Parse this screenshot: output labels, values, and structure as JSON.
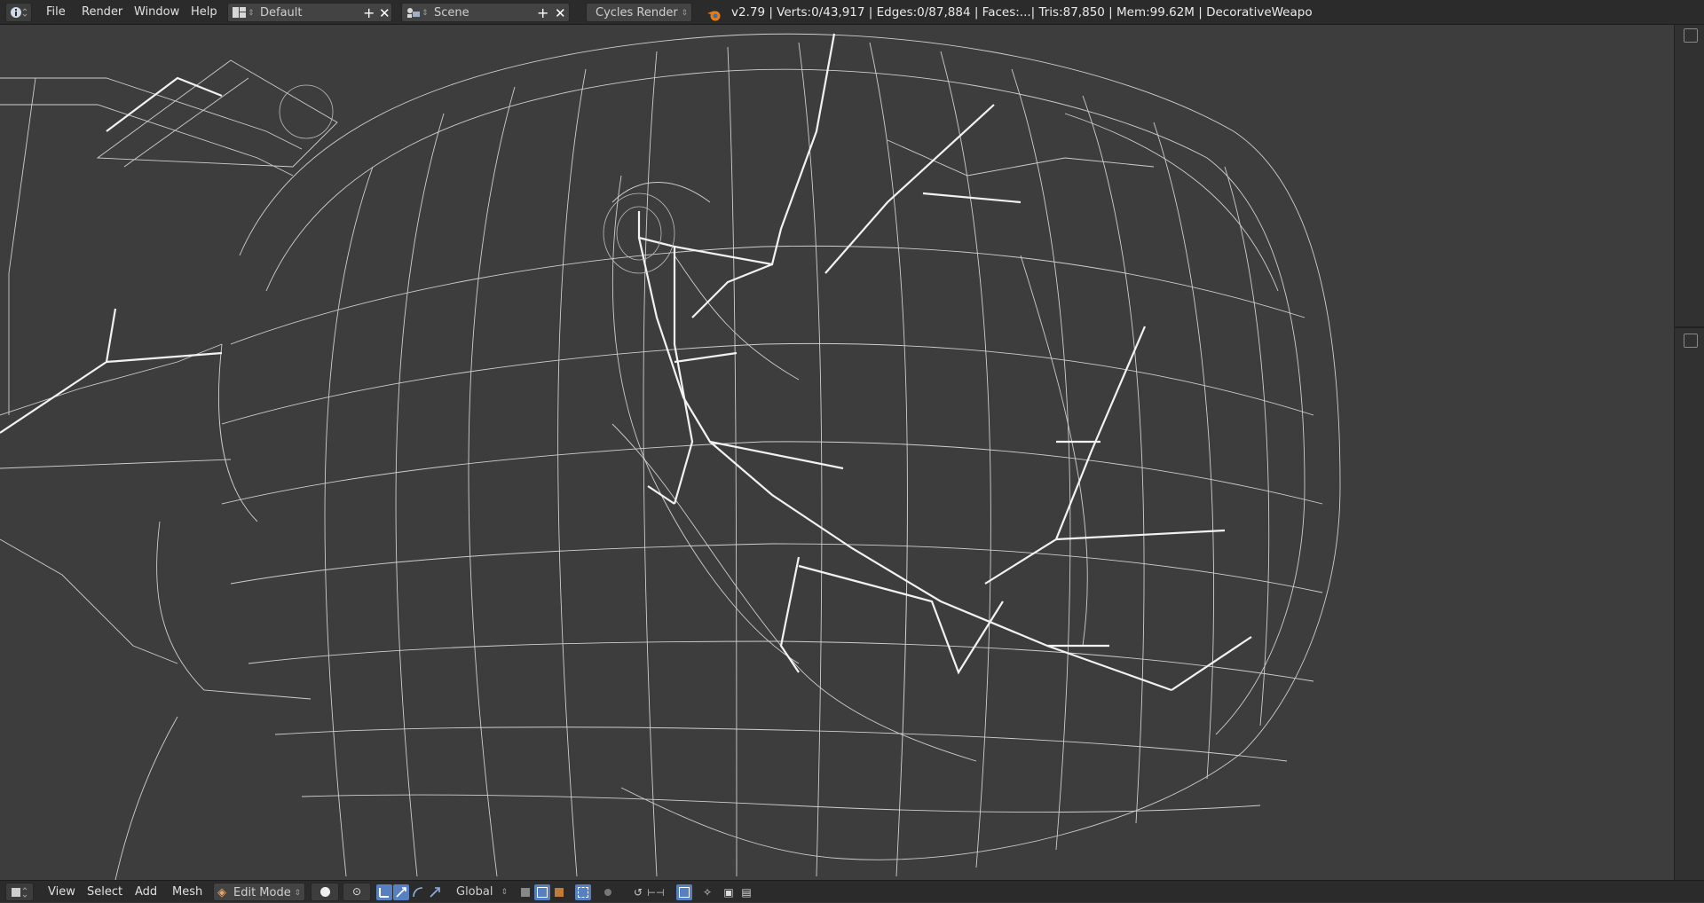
{
  "menubar": {
    "info_icon": "info-icon",
    "menus": [
      "File",
      "Render",
      "Window",
      "Help"
    ],
    "layout": {
      "value": "Default",
      "icon": "screen-layout-icon"
    },
    "scene": {
      "value": "Scene",
      "icon": "scene-icon"
    },
    "render_engine": "Cycles Render",
    "status": "v2.79 | Verts:0/43,917 | Edges:0/87,884 | Faces:...| Tris:87,850 | Mem:99.62M | DecorativeWeapo"
  },
  "viewport": {
    "mode_description": "3D View wireframe of mesh in edit mode",
    "background_color": "#3d3d3d",
    "wire_color": "#e8e8e8"
  },
  "footer": {
    "menus": [
      "View",
      "Select",
      "Add",
      "Mesh"
    ],
    "mode": "Edit Mode",
    "orientation": "Global"
  }
}
